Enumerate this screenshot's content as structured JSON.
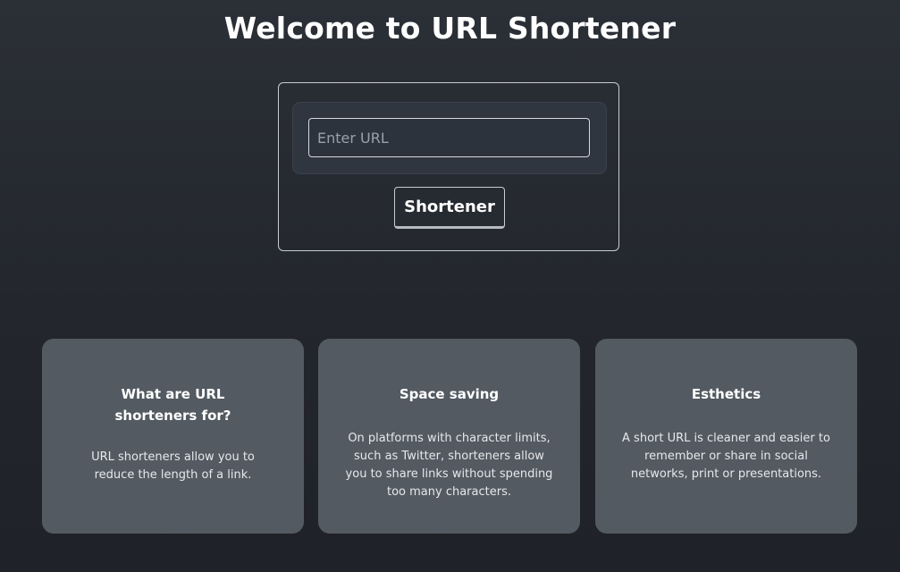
{
  "header": {
    "title": "Welcome to URL Shortener"
  },
  "form": {
    "url_placeholder": "Enter URL",
    "url_value": "",
    "submit_label": "Shortener"
  },
  "cards": [
    {
      "title": "What are URL shorteners for?",
      "text": "URL shorteners allow you to reduce the length of a link."
    },
    {
      "title": "Space saving",
      "text": "On platforms with character limits, such as Twitter, shorteners allow you to share links without spending too many characters."
    },
    {
      "title": "Esthetics",
      "text": "A short URL is cleaner and easier to remember or share in social networks, print or presentations."
    }
  ]
}
